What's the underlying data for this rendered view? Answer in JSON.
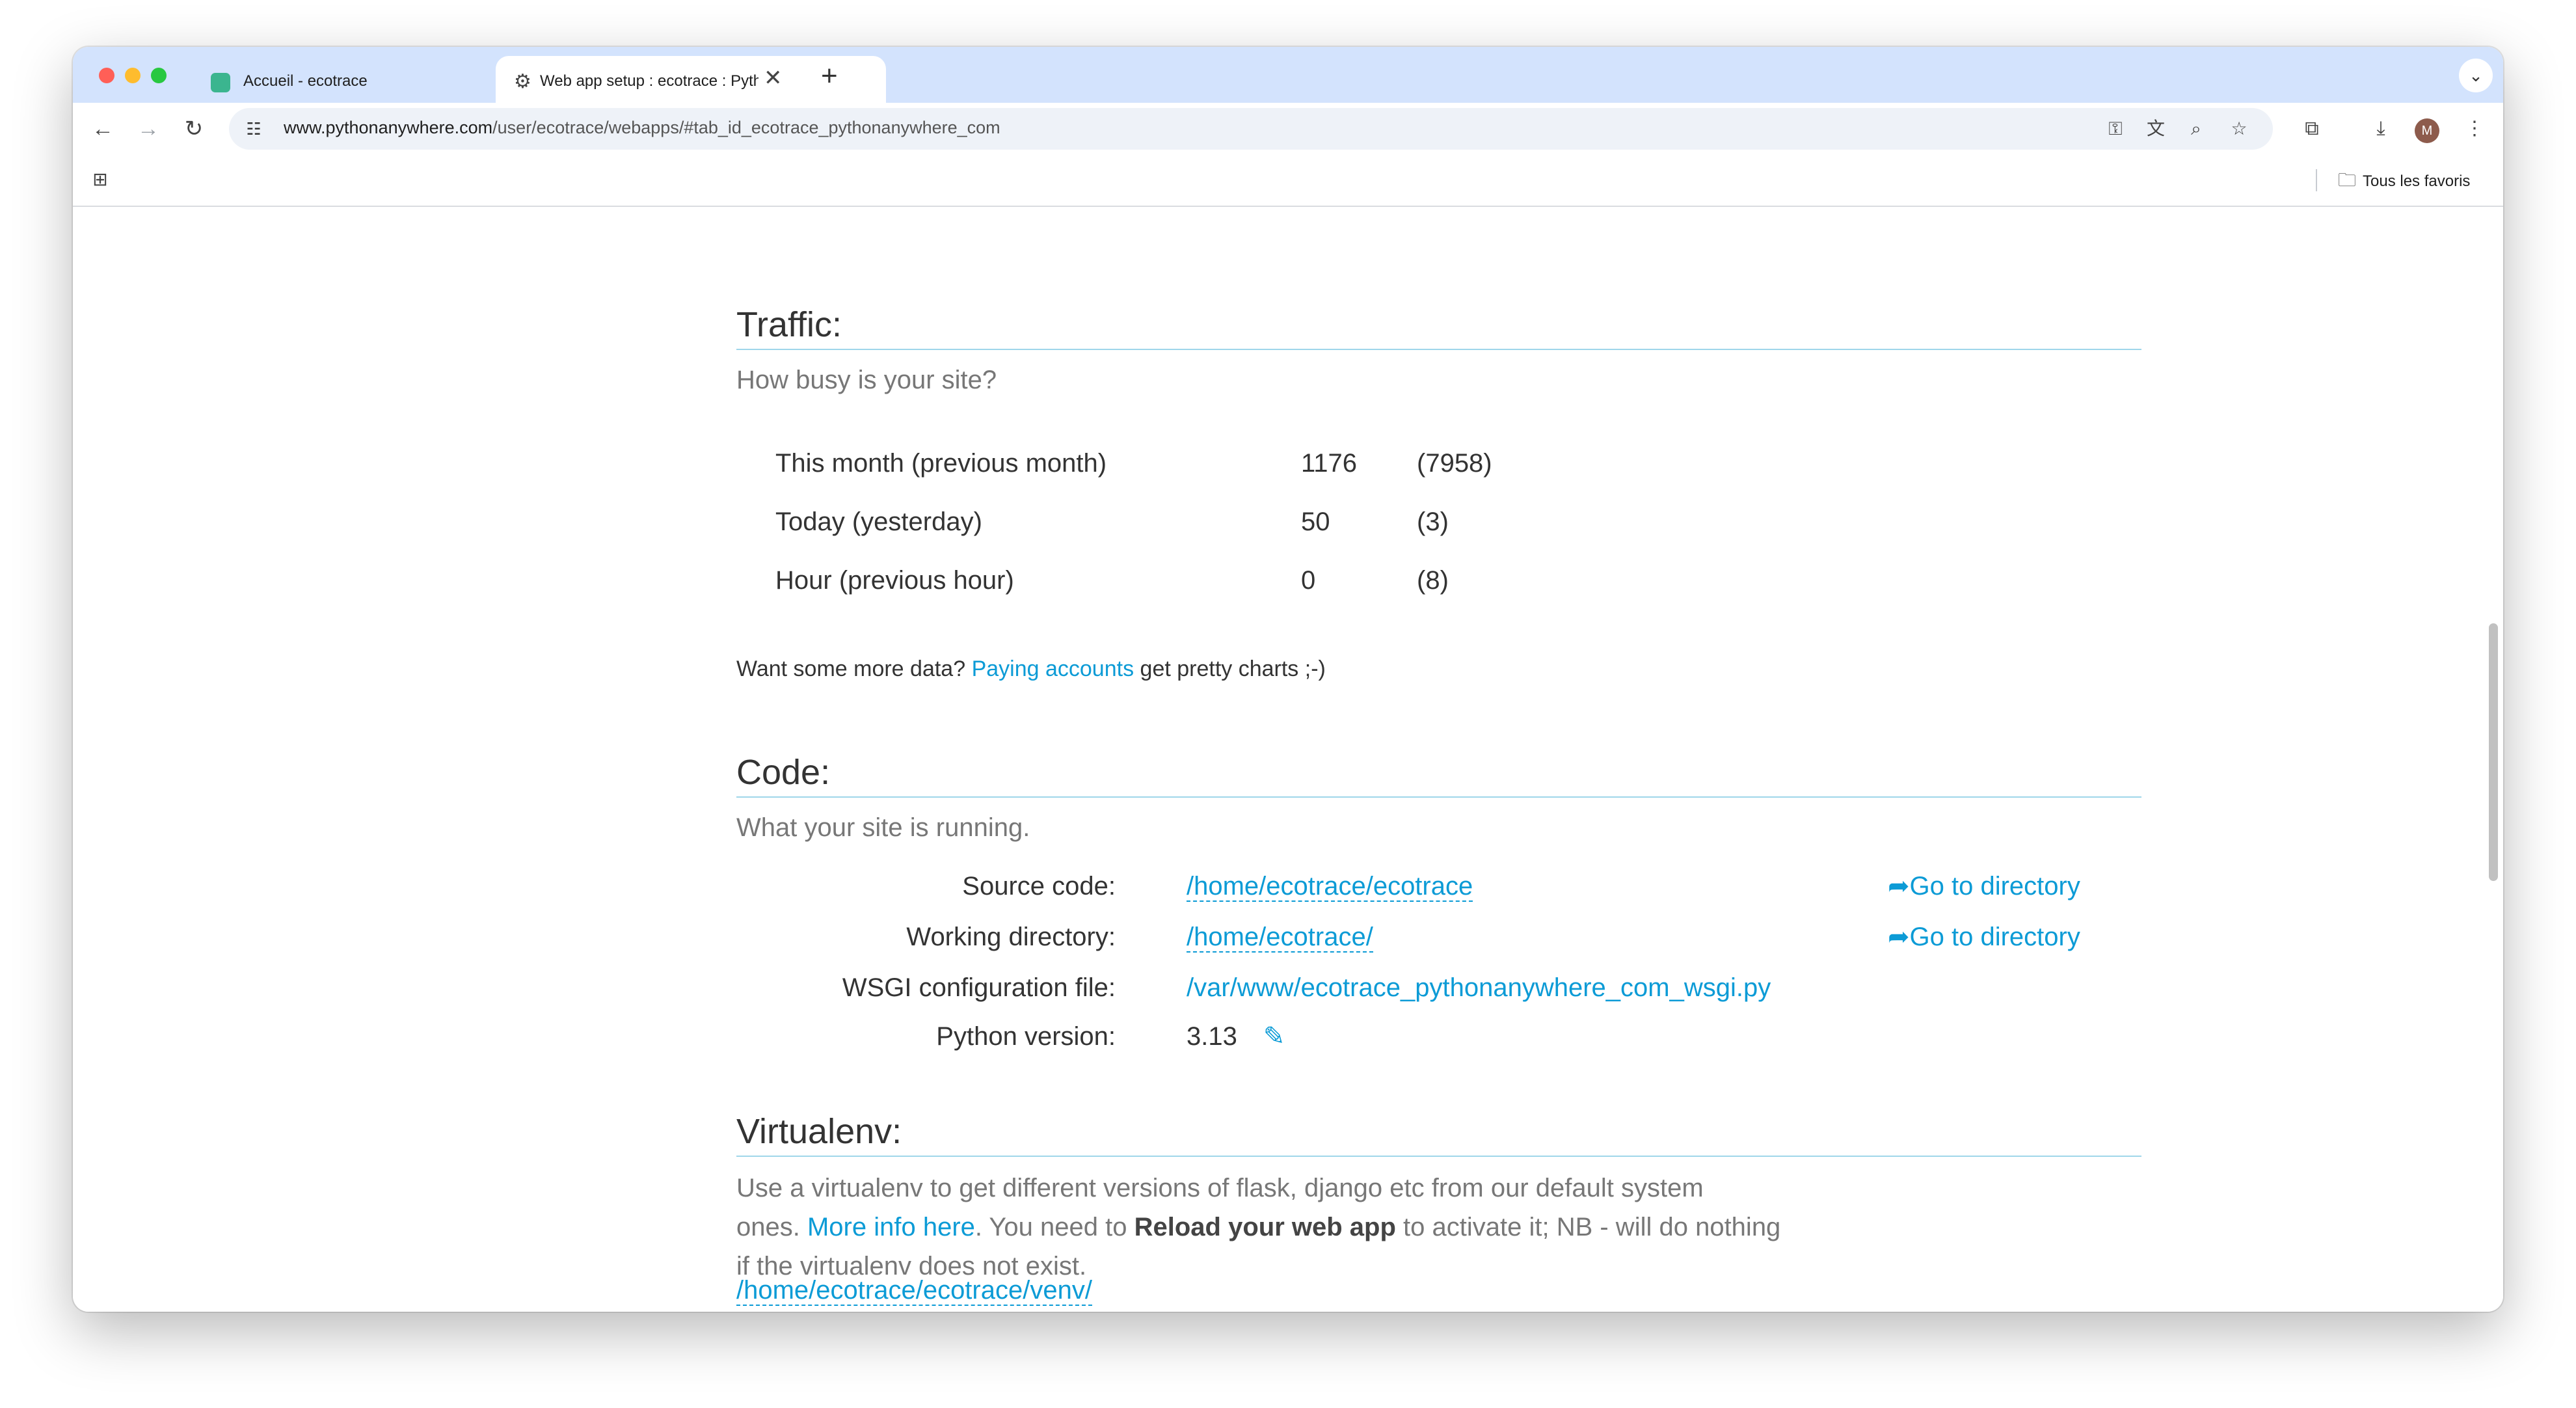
{
  "tabs": [
    {
      "title": "Accueil - ecotrace",
      "close": "✕"
    },
    {
      "title": "Web app setup : ecotrace : PythonAnywhere",
      "close": "✕"
    }
  ],
  "new_tab": "+",
  "tab_menu": "⌄",
  "toolbar": {
    "url_host": "www.pythonanywhere.com",
    "url_path": "/user/ecotrace/webapps/#tab_id_ecotrace_pythonanywhere_com",
    "avatar_letter": "M"
  },
  "bookmarks": {
    "all_favorites": "Tous les favoris"
  },
  "traffic": {
    "title": "Traffic:",
    "subtitle": "How busy is your site?",
    "rows": [
      {
        "label": "This month (previous month)",
        "value": "1176",
        "previous": "(7958)"
      },
      {
        "label": "Today (yesterday)",
        "value": "50",
        "previous": "(3)"
      },
      {
        "label": "Hour (previous hour)",
        "value": "0",
        "previous": "(8)"
      }
    ],
    "more_prefix": "Want some more data?",
    "more_link": "Paying accounts",
    "more_suffix": "get pretty charts ;-)"
  },
  "code": {
    "title": "Code:",
    "subtitle": "What your site is running.",
    "source_label": "Source code:",
    "source_value": "/home/ecotrace/ecotrace",
    "working_label": "Working directory:",
    "working_value": "/home/ecotrace/",
    "wsgi_label": "WSGI configuration file:",
    "wsgi_value": "/var/www/ecotrace_pythonanywhere_com_wsgi.py",
    "python_label": "Python version:",
    "python_value": "3.13",
    "goto_label": "Go to directory"
  },
  "virtualenv": {
    "title": "Virtualenv:",
    "line1": "Use a virtualenv to get different versions of flask, django etc from our default system",
    "line2_prefix": "ones.",
    "more_info_link": "More info here",
    "line2_middle": ". You need to",
    "reload_bold": "Reload your web app",
    "line2_suffix": "to activate it; NB - will do nothing",
    "line3": "if the virtualenv does not exist.",
    "path": "/home/ecotrace/ecotrace/venv/"
  },
  "colors": {
    "accent": "#0c9bd6",
    "tabstrip": "#d3e3fd",
    "close_dot": "#ff5f57",
    "minimize_dot": "#febc2e",
    "maximize_dot": "#28c840"
  }
}
